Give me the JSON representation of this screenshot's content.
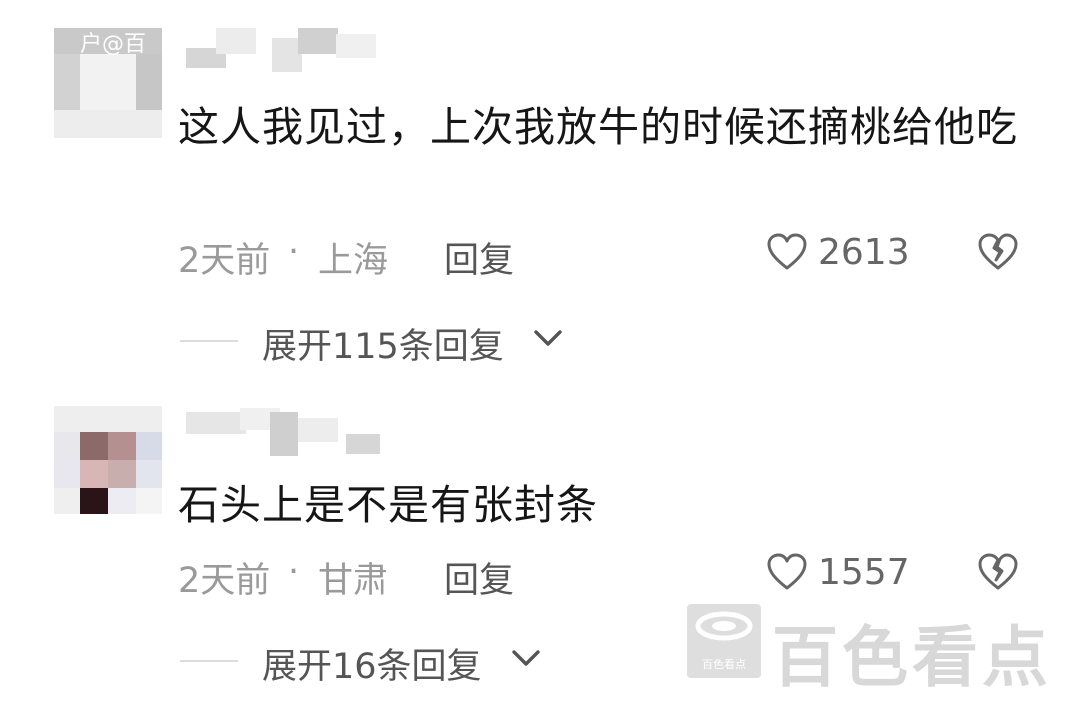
{
  "top_tag": "户@百",
  "comments": [
    {
      "text": "这人我见过，上次我放牛的时候还摘桃给他吃",
      "time": "2天前",
      "location": "上海",
      "reply_label": "回复",
      "likes": "2613",
      "expand_label": "展开115条回复"
    },
    {
      "text": "石头上是不是有张封条",
      "time": "2天前",
      "location": "甘肃",
      "reply_label": "回复",
      "likes": "1557",
      "expand_label": "展开16条回复"
    }
  ],
  "watermark": {
    "text": "百色看点",
    "logo_label": "百色看点"
  },
  "icons": {
    "like": "heart-outline-icon",
    "dislike": "broken-heart-icon",
    "expand": "chevron-down-icon"
  },
  "colors": {
    "text": "#161616",
    "meta": "#9a9a9a",
    "action": "#555555",
    "watermark": "#d8d8d8"
  }
}
